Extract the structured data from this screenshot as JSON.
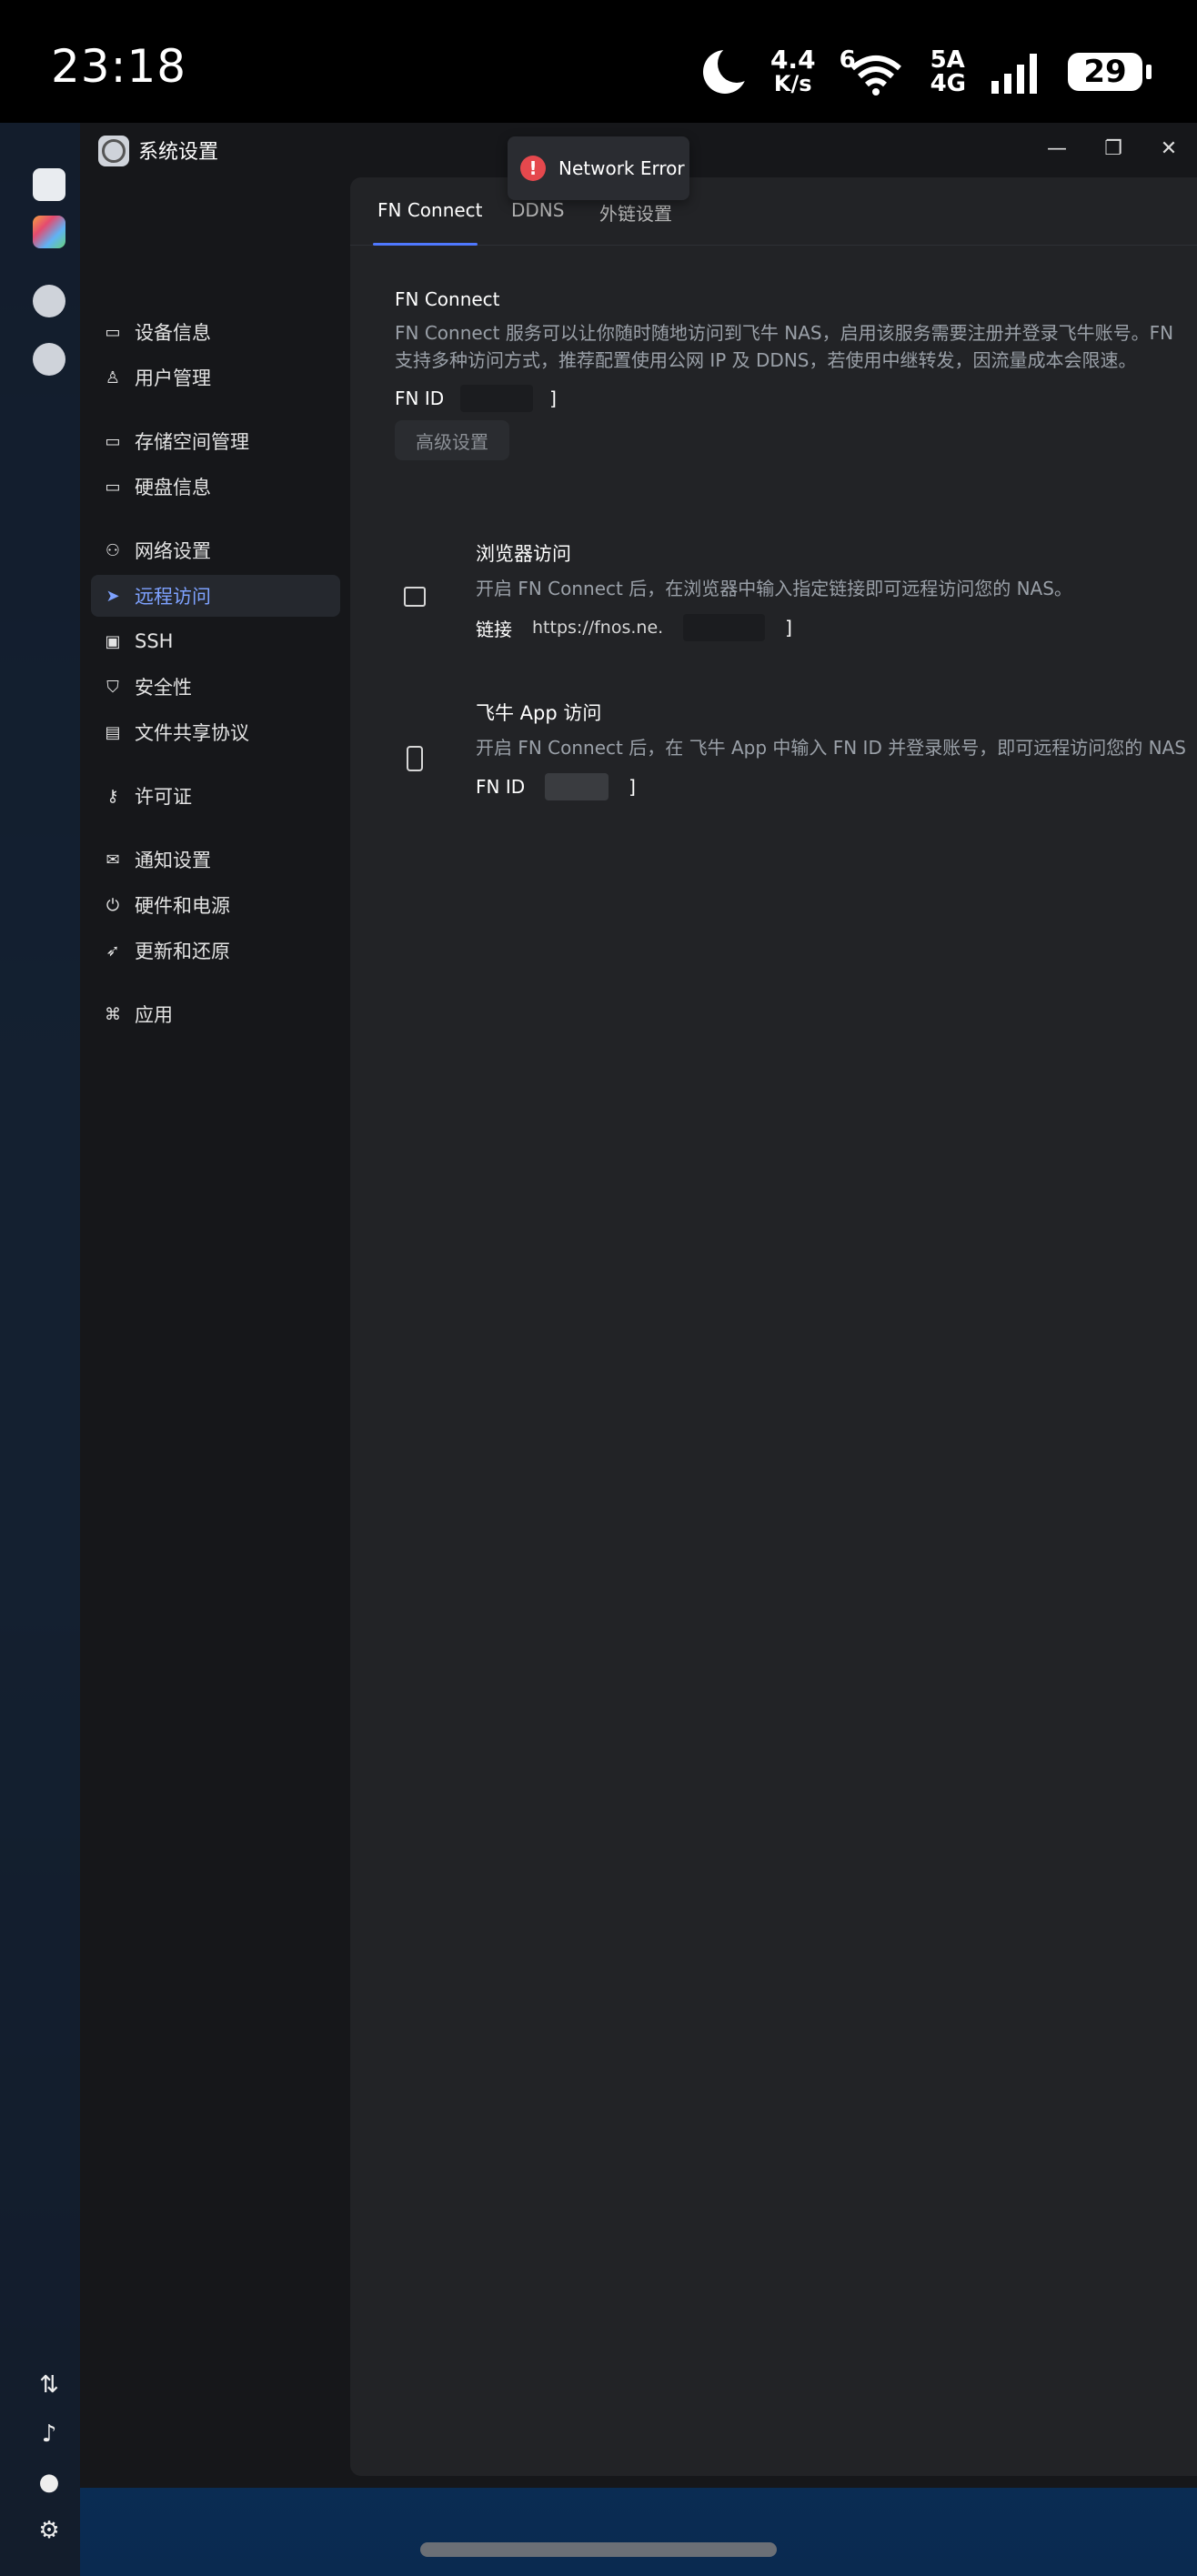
{
  "status_bar": {
    "time": "23:18",
    "net_speed_value": "4.4",
    "net_speed_unit": "K/s",
    "wifi_label": "6",
    "cell_top": "5A",
    "cell_bottom": "4G",
    "battery": "29"
  },
  "window": {
    "title": "系统设置",
    "minimize_glyph": "—",
    "restore_glyph": "❐",
    "close_glyph": "✕"
  },
  "toast": {
    "icon": "!",
    "message": "Network Error"
  },
  "sidebar": {
    "items": [
      {
        "label": "设备信息",
        "icon": "hdd-icon"
      },
      {
        "label": "用户管理",
        "icon": "user-icon"
      },
      {
        "label": "存储空间管理",
        "icon": "storage-icon"
      },
      {
        "label": "硬盘信息",
        "icon": "disk-icon"
      },
      {
        "label": "网络设置",
        "icon": "network-icon"
      },
      {
        "label": "远程访问",
        "icon": "send-icon"
      },
      {
        "label": "SSH",
        "icon": "terminal-icon"
      },
      {
        "label": "安全性",
        "icon": "shield-icon"
      },
      {
        "label": "文件共享协议",
        "icon": "file-icon"
      },
      {
        "label": "许可证",
        "icon": "key-icon"
      },
      {
        "label": "通知设置",
        "icon": "mail-icon"
      },
      {
        "label": "硬件和电源",
        "icon": "power-icon"
      },
      {
        "label": "更新和还原",
        "icon": "rocket-icon"
      },
      {
        "label": "应用",
        "icon": "apps-icon"
      }
    ],
    "active_index": 5
  },
  "tabs": [
    {
      "label": "FN Connect"
    },
    {
      "label": "DDNS"
    },
    {
      "label": "外链设置"
    }
  ],
  "fn_connect": {
    "title": "FN Connect",
    "desc_line1": "FN Connect 服务可以让你随时随地访问到飞牛 NAS，启用该服务需要注册并登录飞牛账号。FN",
    "desc_line2": "支持多种访问方式，推荐配置使用公网 IP 及 DDNS，若使用中继转发，因流量成本会限速。",
    "fnid_label": "FN ID",
    "fnid_tail": "]",
    "advanced_button": "高级设置"
  },
  "browser_access": {
    "title": "浏览器访问",
    "desc": "开启 FN Connect 后，在浏览器中输入指定链接即可远程访问您的 NAS。",
    "link_label": "链接",
    "link_value": "https://fnos.ne.",
    "link_tail": "]"
  },
  "app_access": {
    "title": "飞牛 App 访问",
    "desc": "开启 FN Connect 后，在 飞牛 App 中输入 FN ID 并登录账号，即可远程访问您的 NAS",
    "fnid_label": "FN ID",
    "fnid_tail": "]"
  },
  "colors": {
    "accent": "#4f78ff",
    "active_text": "#7ea2ff",
    "error": "#e5484d"
  }
}
